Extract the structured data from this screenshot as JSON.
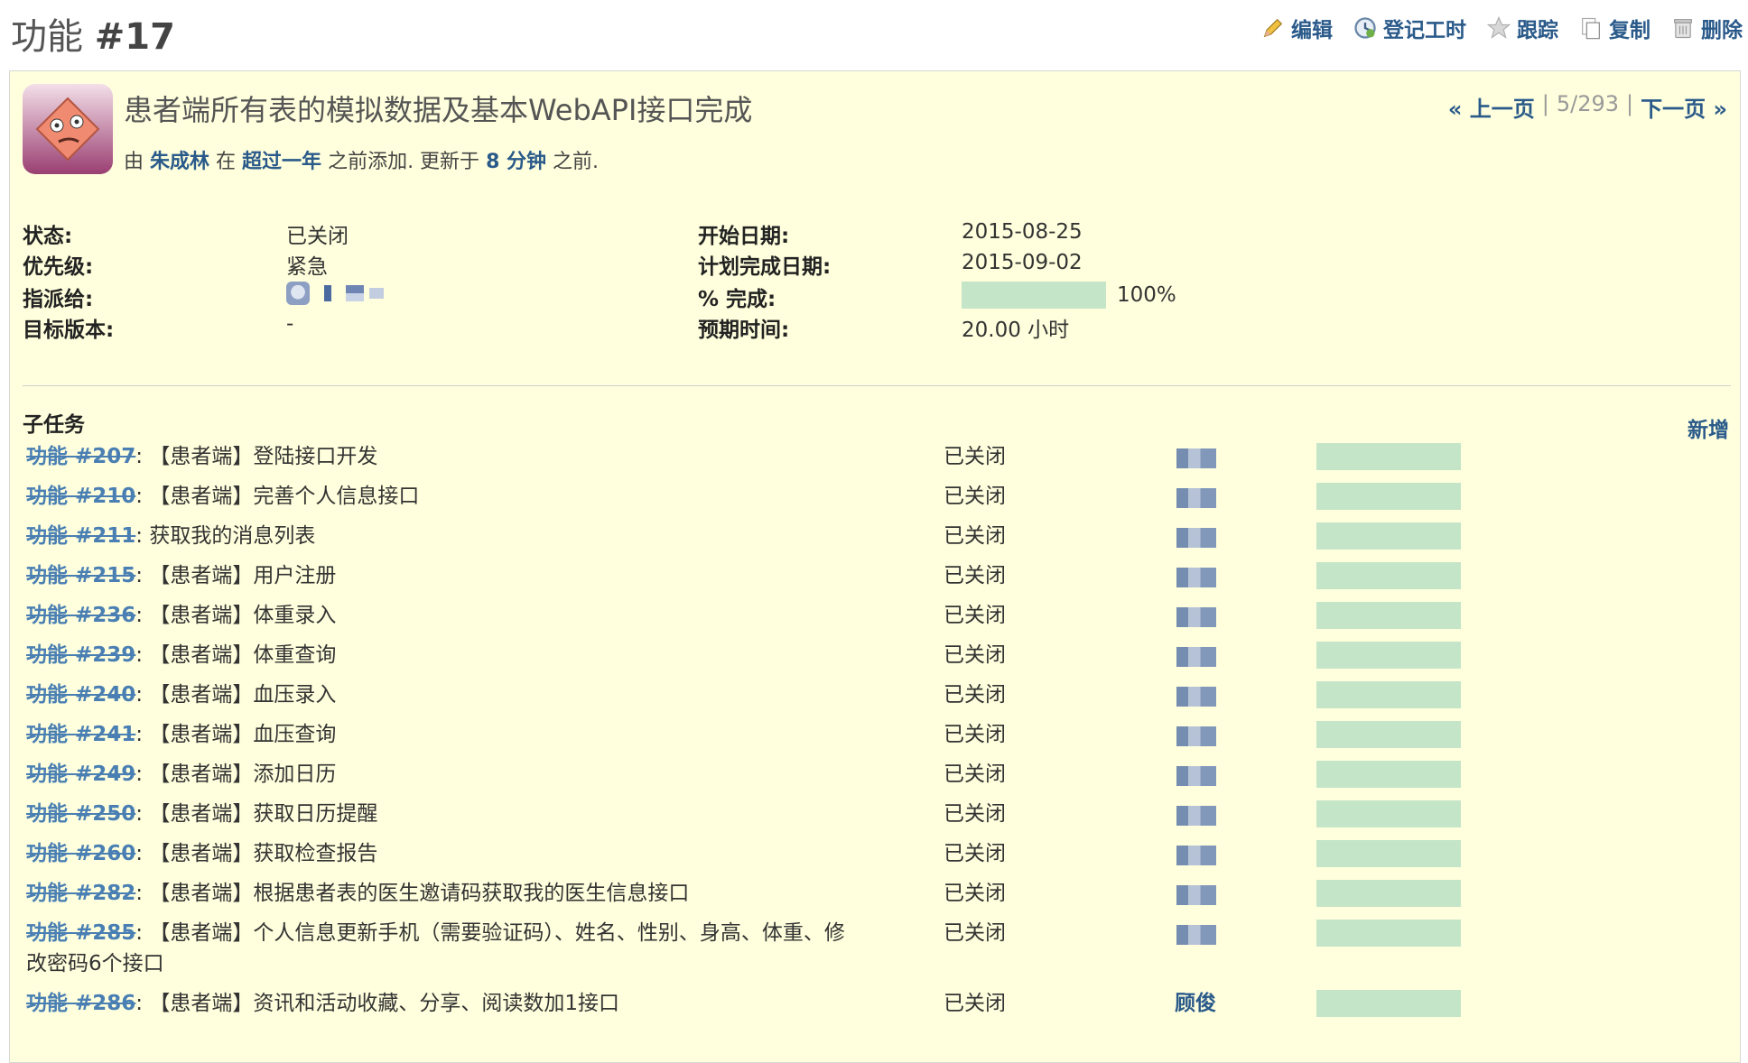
{
  "header": {
    "tracker": "功能",
    "number": "#17",
    "actions": [
      {
        "label": "编辑",
        "icon": "pencil-icon"
      },
      {
        "label": "登记工时",
        "icon": "clock-icon"
      },
      {
        "label": "跟踪",
        "icon": "star-icon"
      },
      {
        "label": "复制",
        "icon": "copy-icon"
      },
      {
        "label": "删除",
        "icon": "trash-icon"
      }
    ]
  },
  "issue": {
    "subject": "患者端所有表的模拟数据及基本WebAPI接口完成",
    "byline": {
      "prefix": "由",
      "author": "朱成林",
      "in": "在",
      "added_ago": "超过一年",
      "added_suffix": "之前添加. 更新于",
      "updated_ago": "8 分钟",
      "updated_suffix": "之前."
    },
    "nav": {
      "prev": "« 上一页",
      "position": "5/293",
      "next": "下一页 »",
      "sep": "|"
    }
  },
  "attributes": {
    "status_label": "状态:",
    "status": "已关闭",
    "priority_label": "优先级:",
    "priority": "紧急",
    "assignee_label": "指派给:",
    "target_label": "目标版本:",
    "target": "-",
    "start_label": "开始日期:",
    "start": "2015-08-25",
    "due_label": "计划完成日期:",
    "due": "2015-09-02",
    "done_label": "% 完成:",
    "done": "100%",
    "done_fraction": 1.0,
    "estimate_label": "预期时间:",
    "estimate": "20.00 小时"
  },
  "subtasks": {
    "title": "子任务",
    "add": "新增",
    "items": [
      {
        "id": "功能 #207",
        "text": ": 【患者端】登陆接口开发",
        "status": "已关闭",
        "assignee": "",
        "done": 1.0
      },
      {
        "id": "功能 #210",
        "text": ": 【患者端】完善个人信息接口",
        "status": "已关闭",
        "assignee": "",
        "done": 1.0
      },
      {
        "id": "功能 #211",
        "text": ": 获取我的消息列表",
        "status": "已关闭",
        "assignee": "",
        "done": 1.0
      },
      {
        "id": "功能 #215",
        "text": ": 【患者端】用户注册",
        "status": "已关闭",
        "assignee": "",
        "done": 1.0
      },
      {
        "id": "功能 #236",
        "text": ": 【患者端】体重录入",
        "status": "已关闭",
        "assignee": "",
        "done": 1.0
      },
      {
        "id": "功能 #239",
        "text": ": 【患者端】体重查询",
        "status": "已关闭",
        "assignee": "",
        "done": 1.0
      },
      {
        "id": "功能 #240",
        "text": ": 【患者端】血压录入",
        "status": "已关闭",
        "assignee": "",
        "done": 1.0
      },
      {
        "id": "功能 #241",
        "text": ": 【患者端】血压查询",
        "status": "已关闭",
        "assignee": "",
        "done": 1.0
      },
      {
        "id": "功能 #249",
        "text": ": 【患者端】添加日历",
        "status": "已关闭",
        "assignee": "",
        "done": 1.0
      },
      {
        "id": "功能 #250",
        "text": ": 【患者端】获取日历提醒",
        "status": "已关闭",
        "assignee": "",
        "done": 1.0
      },
      {
        "id": "功能 #260",
        "text": ": 【患者端】获取检查报告",
        "status": "已关闭",
        "assignee": "",
        "done": 1.0
      },
      {
        "id": "功能 #282",
        "text": ": 【患者端】根据患者表的医生邀请码获取我的医生信息接口",
        "status": "已关闭",
        "assignee": "",
        "done": 1.0
      },
      {
        "id": "功能 #285",
        "text": ": 【患者端】个人信息更新手机（需要验证码）、姓名、性别、身高、体重、修改密码6个接口",
        "status": "已关闭",
        "assignee": "",
        "done": 1.0
      },
      {
        "id": "功能 #286",
        "text": ": 【患者端】资讯和活动收藏、分享、阅读数加1接口",
        "status": "已关闭",
        "assignee": "顾俊",
        "done": 1.0
      }
    ]
  }
}
